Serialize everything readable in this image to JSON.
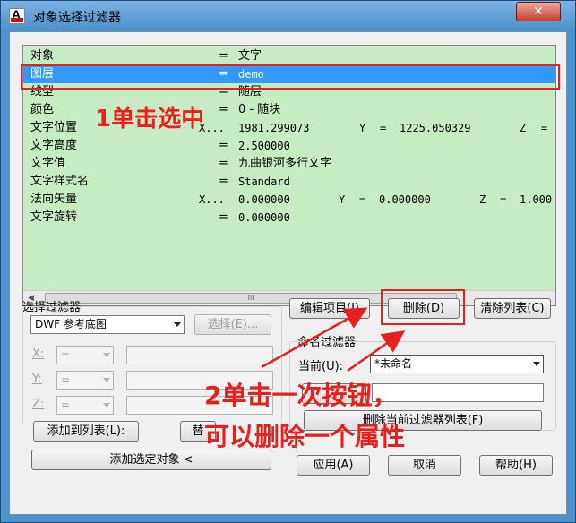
{
  "window": {
    "title": "对象选择过滤器",
    "close_glyph": "✕",
    "app_icon_letter": "A"
  },
  "list": {
    "rows": [
      {
        "name": "对象",
        "op": "=",
        "value": "文字"
      },
      {
        "name": "图层",
        "op": "=",
        "value": "demo",
        "selected": true
      },
      {
        "name": "线型",
        "op": "=",
        "value": "随层"
      },
      {
        "name": "颜色",
        "op": "=",
        "value": "0 - 随块"
      },
      {
        "name": "文字位置",
        "op": "X...",
        "value": "1981.299073",
        "y_label": "Y",
        "y_op": "=",
        "y_value": "1225.050329",
        "z_label": "Z",
        "z_op": "="
      },
      {
        "name": "文字高度",
        "op": "=",
        "value": "2.500000"
      },
      {
        "name": "文字值",
        "op": "=",
        "value": "九曲银河多行文字"
      },
      {
        "name": "文字样式名",
        "op": "=",
        "value": "Standard"
      },
      {
        "name": "法向矢量",
        "op": "X...",
        "value": "0.000000",
        "y_label": "Y",
        "y_op": "=",
        "y_value": "0.000000",
        "z_label": "Z",
        "z_op": "=",
        "z_value": "1.000"
      },
      {
        "name": "文字旋转",
        "op": "=",
        "value": "0.000000"
      }
    ],
    "scroll_left": "◀",
    "scroll_thumb": "III"
  },
  "filter": {
    "group_title": "选择过滤器",
    "type_value": "DWF 参考底图",
    "select_button": "选择(E)...",
    "x_label": "X:",
    "y_label": "Y:",
    "z_label": "Z:",
    "op_value": "=",
    "add_to_list": "添加到列表(L):",
    "replace": "替",
    "add_selected": "添加选定对象 <"
  },
  "buttons": {
    "edit_item": "编辑项目(I)",
    "delete": "删除(D)",
    "clear_list": "清除列表(C)"
  },
  "named": {
    "group_title": "命名过滤器",
    "current_label": "当前(U):",
    "current_value": "*未命名",
    "save_as_prefix": "",
    "delete_current": "删除当前过滤器列表(F)"
  },
  "footer": {
    "apply": "应用(A)",
    "cancel": "取消",
    "help": "帮助(H)"
  },
  "annotations": {
    "step1": "1单击选中",
    "step2_line1": "2单击一次按钮，",
    "step2_line2": "可以删除一个属性"
  },
  "colors": {
    "list_bg": "#c7ebc3",
    "selected": "#3399ff",
    "annotation": "#e8201b"
  }
}
